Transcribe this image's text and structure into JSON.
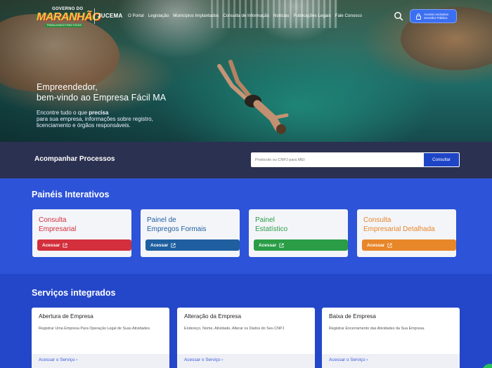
{
  "brand": {
    "logo_top": "GOVERNO DO",
    "logo_word": "MARANHÃO",
    "logo_tag": "TRABALHANDO PARA TODOS",
    "agency": "JUCEMA"
  },
  "nav": {
    "items": [
      {
        "label": "O Portal"
      },
      {
        "label": "Legislação"
      },
      {
        "label": "Municípios Implantados"
      },
      {
        "label": "Consulta de Informação"
      },
      {
        "label": "Notícias"
      },
      {
        "label": "Publicações Legais"
      },
      {
        "label": "Fale Conosco"
      }
    ],
    "servidor_line1": "Acesso exclusivo",
    "servidor_line2": "Servidor Público"
  },
  "hero": {
    "title_line1": "Empreendedor,",
    "title_line2": "bem-vindo ao Empresa Fácil MA",
    "sub_line1_pre": "Encontre tudo o que ",
    "sub_line1_bold": "precisa",
    "sub_line2": "para sua empresa, informações sobre registro,",
    "sub_line3": "licenciamento e órgãos responsáveis."
  },
  "track": {
    "title": "Acompanhar Processos",
    "placeholder": "Protocolo ou CNPJ para MEI",
    "button": "Consultar"
  },
  "paineis": {
    "title": "Painéis Interativos",
    "cards": [
      {
        "line1": "Consulta",
        "line2": "Empresarial",
        "button": "Acessar",
        "color": "#d32f3c"
      },
      {
        "line1": "Painel de",
        "line2": "Empregos Formais",
        "button": "Acessar",
        "color": "#1f5fa0"
      },
      {
        "line1": "Painel",
        "line2": "Estatístico",
        "button": "Acessar",
        "color": "#2a9d46"
      },
      {
        "line1": "Consulta",
        "line2": "Empresarial Detalhada",
        "button": "Acessar",
        "color": "#e8862a"
      }
    ]
  },
  "servicos": {
    "title": "Serviços integrados",
    "cards": [
      {
        "title": "Abertura de Empresa",
        "desc": "Registrar Uma Empresa Para Operação Legal de Suas Atividades.",
        "link": "Acessar o Serviço"
      },
      {
        "title": "Alteração da Empresa",
        "desc": "Endereço, Nome, Atividade, Alterar os Dados do Seu CNPJ",
        "link": "Acessar o Serviço"
      },
      {
        "title": "Baixa de Empresa",
        "desc": "Registrar Encerramento das Atividades da Sua Empresa.",
        "link": "Acessar o Serviço"
      }
    ]
  }
}
